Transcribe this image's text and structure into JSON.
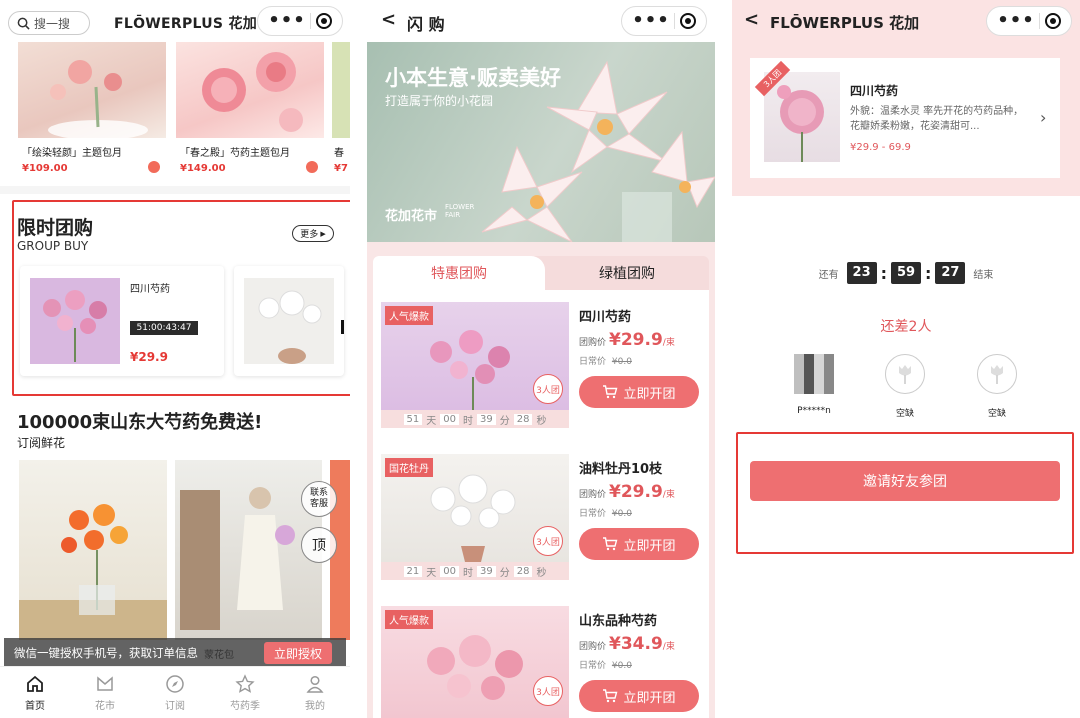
{
  "panel1": {
    "search_placeholder": "搜一搜",
    "title": "FLŌWERPLUS 花加",
    "top_products": [
      {
        "name": "「绘染轻颜」主题包月",
        "price": "¥109.00"
      },
      {
        "name": "「春之殿」芍药主题包月",
        "price": "¥149.00"
      },
      {
        "name": "春",
        "price": "¥7"
      }
    ],
    "group_buy": {
      "title": "限时团购",
      "subtitle": "GROUP BUY",
      "more": "更多",
      "item": {
        "name": "四川芍药",
        "countdown": "51:00:43:47",
        "price": "¥29.9"
      }
    },
    "promo": {
      "title": "100000束山东大芍药免费送!",
      "subtitle": "订阅鲜花"
    },
    "float_buttons": {
      "service": "联系\n客服",
      "top": "顶"
    },
    "auth_bar": {
      "text": "微信一键授权手机号，获取订单信息",
      "behind": "蒙花包",
      "button": "立即授权"
    },
    "tabs": [
      "首页",
      "花市",
      "订阅",
      "芍药季",
      "我的"
    ]
  },
  "panel2": {
    "nav_title": "闪 购",
    "banner": {
      "title": "小本生意·贩卖美好",
      "subtitle": "打造属于你的小花园",
      "brand": "花加花市",
      "brand_en": "FLOWER\nFAIR"
    },
    "tabs": [
      "特惠团购",
      "绿植团购"
    ],
    "products": [
      {
        "tag": "人气爆款",
        "name": "四川芍药",
        "group_label": "团购价",
        "price": "¥29.9",
        "unit": "/束",
        "daily_label": "日常价",
        "daily": "¥0.0",
        "badge": "3人团",
        "button": "立即开团",
        "cd": [
          "51",
          "天",
          "00",
          "时",
          "39",
          "分",
          "28",
          "秒"
        ]
      },
      {
        "tag": "国花牡丹",
        "name": "油料牡丹10枝",
        "group_label": "团购价",
        "price": "¥29.9",
        "unit": "/束",
        "daily_label": "日常价",
        "daily": "¥0.0",
        "badge": "3人团",
        "button": "立即开团",
        "cd": [
          "21",
          "天",
          "00",
          "时",
          "39",
          "分",
          "28",
          "秒"
        ]
      },
      {
        "tag": "人气爆款",
        "name": "山东品种芍药",
        "group_label": "团购价",
        "price": "¥34.9",
        "unit": "/束",
        "daily_label": "日常价",
        "daily": "¥0.0",
        "badge": "3人团",
        "button": "立即开团"
      }
    ]
  },
  "panel3": {
    "title": "FLŌWERPLUS 花加",
    "card": {
      "ribbon": "3人团",
      "name": "四川芍药",
      "desc": "外貌：温柔水灵 率先开花的芍药品种，花瓣娇柔粉嫩，花姿清甜可...",
      "price_range": "¥29.9 - 69.9"
    },
    "countdown": {
      "prefix": "还有",
      "h": "23",
      "m": "59",
      "s": "27",
      "suffix": "结束"
    },
    "status": "还差2人",
    "members": [
      {
        "name": "P*****n"
      },
      {
        "name": "空缺"
      },
      {
        "name": "空缺"
      }
    ],
    "invite_button": "邀请好友参团"
  },
  "colors": {
    "accent": "#ee6f71",
    "price_red": "#e53935",
    "highlight_border": "#e53935"
  }
}
